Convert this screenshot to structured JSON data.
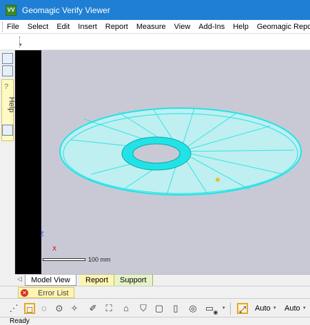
{
  "window": {
    "title": "Geomagic Verify Viewer",
    "icon_label": "VV"
  },
  "menu": [
    "File",
    "Select",
    "Edit",
    "Insert",
    "Report",
    "Measure",
    "View",
    "Add-Ins",
    "Help",
    "Geomagic Report"
  ],
  "left_panel": {
    "help_label": "Help"
  },
  "viewport": {
    "scale_label": "100 mm",
    "axis_z": "Z",
    "axis_x": "X"
  },
  "tabs": [
    "Model View",
    "Report",
    "Support"
  ],
  "error_list": {
    "label": "Error List"
  },
  "bottom_toolbar": {
    "auto1": "Auto",
    "auto2": "Auto"
  },
  "status": {
    "text": "Ready"
  },
  "colors": {
    "titlebar": "#1f7fd4",
    "mesh": "#21e3e6",
    "viewport_bg": "#c9c9d6",
    "highlight": "#e2a72c"
  }
}
